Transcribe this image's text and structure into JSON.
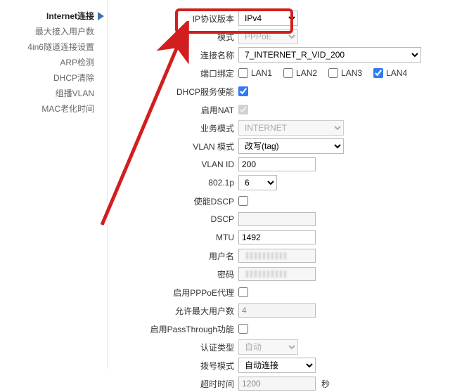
{
  "sidebar": {
    "items": [
      {
        "label": "Internet连接"
      },
      {
        "label": "最大接入用户数"
      },
      {
        "label": "4in6隧道连接设置"
      },
      {
        "label": "ARP检测"
      },
      {
        "label": "DHCP清除"
      },
      {
        "label": "组播VLAN"
      },
      {
        "label": "MAC老化时间"
      }
    ]
  },
  "form": {
    "ip_version": {
      "label": "IP协议版本",
      "value": "IPv4"
    },
    "mode": {
      "label": "模式",
      "value": "PPPoE"
    },
    "conn_name": {
      "label": "连接名称",
      "value": "7_INTERNET_R_VID_200"
    },
    "port_bind": {
      "label": "端口绑定",
      "lan1": "LAN1",
      "lan1_checked": false,
      "lan2": "LAN2",
      "lan2_checked": false,
      "lan3": "LAN3",
      "lan3_checked": false,
      "lan4": "LAN4",
      "lan4_checked": true
    },
    "dhcp_serv": {
      "label": "DHCP服务使能",
      "checked": true
    },
    "nat": {
      "label": "启用NAT",
      "checked": true
    },
    "biz_mode": {
      "label": "业务模式",
      "value": "INTERNET"
    },
    "vlan_mode": {
      "label": "VLAN 模式",
      "value": "改写(tag)"
    },
    "vlan_id": {
      "label": "VLAN ID",
      "value": "200"
    },
    "p8021": {
      "label": "802.1p",
      "value": "6"
    },
    "dscp_en": {
      "label": "使能DSCP",
      "checked": false
    },
    "dscp": {
      "label": "DSCP",
      "value": ""
    },
    "mtu": {
      "label": "MTU",
      "value": "1492"
    },
    "user": {
      "label": "用户名",
      "value": ""
    },
    "pass": {
      "label": "密码"
    },
    "pppoe_proxy": {
      "label": "启用PPPoE代理",
      "checked": false
    },
    "max_users": {
      "label": "允许最大用户数",
      "value": "4"
    },
    "passthrough": {
      "label": "启用PassThrough功能",
      "checked": false
    },
    "auth_type": {
      "label": "认证类型",
      "value": "自动"
    },
    "dial_mode": {
      "label": "拨号模式",
      "value": "自动连接"
    },
    "timeout": {
      "label": "超时时间",
      "value": "1200",
      "unit": "秒"
    }
  }
}
